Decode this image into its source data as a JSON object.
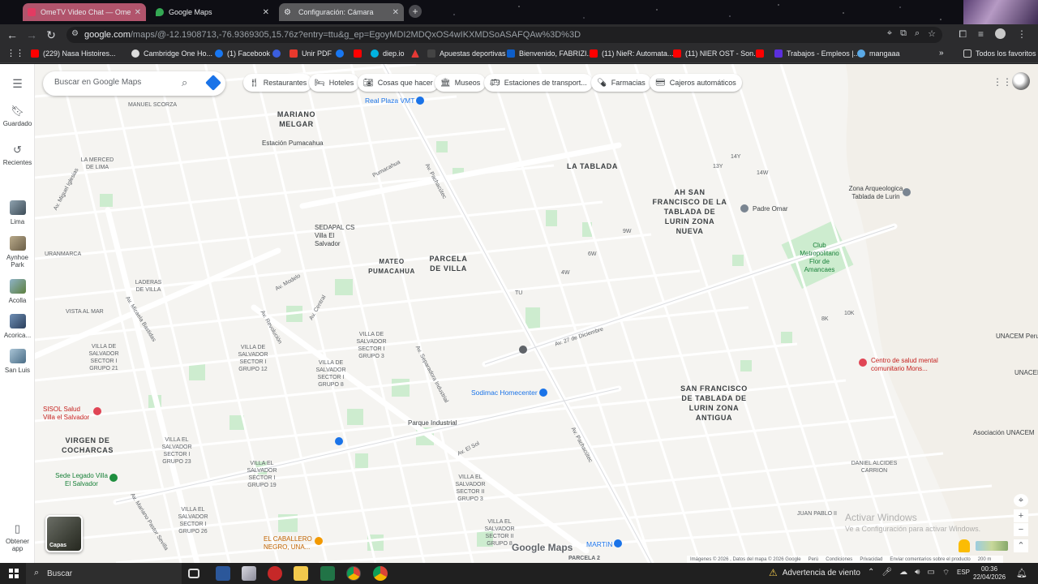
{
  "browser": {
    "tabs": [
      {
        "label": "OmeTV Video Chat — Ome",
        "color": "#b1546c"
      },
      {
        "label": "Google Maps",
        "color": "#34a853"
      },
      {
        "label": "Configuración: Cámara",
        "color": "#8ab4f8"
      }
    ],
    "url_host": "google.com",
    "url_path": "/maps/@-12.1908713,-76.9369305,15.76z?entry=ttu&g_ep=EgoyMDI2MDQxOS4wIKXMDSoASAFQAw%3D%3D",
    "bookmarks": [
      {
        "label": "(229) Nasa Histoires...",
        "color": "#ff0000"
      },
      {
        "label": "Cambridge One Ho...",
        "color": "#dddddd"
      },
      {
        "label": "(1) Facebook",
        "color": "#1877f2"
      },
      {
        "label": "",
        "color": "#3b5ede"
      },
      {
        "label": "Unir PDF",
        "color": "#e8392d"
      },
      {
        "label": "",
        "color": "#1877f2"
      },
      {
        "label": "",
        "color": "#ff0000"
      },
      {
        "label": "diep.io",
        "color": "#00b2e1"
      },
      {
        "label": "",
        "color": "#e53935"
      },
      {
        "label": "Apuestas deportivas",
        "color": "#444444"
      },
      {
        "label": "Bienvenido, FABRIZI...",
        "color": "#0e5ec9"
      },
      {
        "label": "(11) NieR: Automata...",
        "color": "#ff0000"
      },
      {
        "label": "(11) NIER OST - Son...",
        "color": "#ff0000"
      },
      {
        "label": "",
        "color": "#ff0000"
      },
      {
        "label": "Trabajos - Empleos |...",
        "color": "#5b2fdd"
      },
      {
        "label": "mangaaa",
        "color": "#5aa9e6"
      }
    ],
    "all_bookmarks": "Todos los favoritos"
  },
  "maps": {
    "search_placeholder": "Buscar en Google Maps",
    "chips": [
      {
        "label": "Restaurantes",
        "icon": "fork-knife-icon",
        "glyph": "🍴"
      },
      {
        "label": "Hoteles",
        "icon": "bed-icon",
        "glyph": "🛏"
      },
      {
        "label": "Cosas que hacer",
        "icon": "camera-icon",
        "glyph": "📷"
      },
      {
        "label": "Museos",
        "icon": "museum-icon",
        "glyph": "🏛"
      },
      {
        "label": "Estaciones de transport...",
        "icon": "bus-icon",
        "glyph": "🚌"
      },
      {
        "label": "Farmacias",
        "icon": "pharmacy-icon",
        "glyph": "💊"
      },
      {
        "label": "Cajeros automáticos",
        "icon": "atm-icon",
        "glyph": "💳"
      }
    ],
    "rail": [
      {
        "label": "Guardado",
        "icon": "bookmark-icon"
      },
      {
        "label": "Recientes",
        "icon": "history-icon"
      },
      {
        "label": "Lima",
        "icon": "lima-thumb"
      },
      {
        "label": "Aynhoe Park",
        "icon": "aynhoe-thumb"
      },
      {
        "label": "Acolla",
        "icon": "acolla-thumb"
      },
      {
        "label": "Acorica...",
        "icon": "acorica-thumb"
      },
      {
        "label": "San Luis",
        "icon": "sanluis-thumb"
      },
      {
        "label": "Obtener app",
        "icon": "phone-icon"
      }
    ],
    "layers_label": "Capas",
    "logo": "Google Maps",
    "footer": [
      "Imágenes © 2026 , Datos del mapa © 2026 Google",
      "Perú",
      "Condiciones",
      "Privacidad",
      "Enviar comentarios sobre el producto",
      "200 m"
    ],
    "activation_title": "Activar Windows",
    "activation_sub": "Ve a Configuración para activar Windows.",
    "labels": {
      "mariano_melgar": "MARIANO MELGAR",
      "la_tablada": "LA TABLADA",
      "ah_san_francisco": "AH SAN FRANCISCO DE LA TABLADA DE LURIN ZONA NUEVA",
      "parcela_villa": "PARCELA DE VILLA",
      "mateo_pumacahua": "MATEO PUMACAHUA",
      "san_francisco_antigua": "SAN FRANCISCO DE TABLADA DE LURIN ZONA ANTIGUA",
      "virgen_cocharcas": "VIRGEN DE COCHARCAS",
      "la_merced": "LA MERCED DE LIMA",
      "manuel_scorza": "MANUEL SCORZA",
      "uranmarca": "URANMARCA",
      "laderas_villa": "LADERAS DE VILLA",
      "vista_al_mar": "VISTA AL MAR",
      "daniel_carrion": "DANIEL ALCIDES CARRION",
      "juan_pablo": "JUAN PABLO II",
      "parcela_2": "PARCELA 2",
      "real_plaza": "Real Plaza VMT",
      "estacion_pumacahua": "Estación Pumacahua",
      "sedapal": "SEDAPAL CS Villa El Salvador",
      "sodimac": "Sodimac Homecenter",
      "parque_industrial": "Parque Industrial",
      "padre_omar": "Padre Omar",
      "zona_arqueologica": "Zona Arqueologica Tablada de Lurin",
      "club_metropolitano": "Club Metropolitano Flor de Amancaes",
      "centro_salud": "Centro de salud mental comunitario Mons...",
      "sisol": "SISOL Salud Villa el Salvador",
      "sede_legado": "Sede Legado Villa El Salvador",
      "el_caballero": "EL CABALLERO NEGRO, UNA...",
      "martin": "MARTIN",
      "unacem_peru": "UNACEM Peru",
      "unacem": "UNACEM",
      "asociacion": "Asociación UNACEM",
      "av_pachacutec": "Av. Pachacútec",
      "av_pachacutec_2": "Av. Pachacútec",
      "av_27_dic": "Av. 27 de Diciembre",
      "av_el_sol": "Av. El Sol",
      "av_modelo": "Av. Modelo",
      "av_revolucion": "Av. Revolución",
      "av_central": "Av. Central",
      "av_mariano": "Av. Mariano Pastor Sevilla",
      "av_micaela": "Av. Micaela Bastidas",
      "av_miguel": "Av. Miguel Iglesias",
      "av_separadora": "Av. Separadora Industrial",
      "pumacahua": "Pumacahua",
      "villa_grupo_21": "VILLA DE SALVADOR SECTOR I GRUPO 21",
      "villa_grupo_12": "VILLA DE SALVADOR SECTOR I GRUPO 12",
      "villa_grupo_3": "VILLA DE SALVADOR SECTOR I GRUPO 3",
      "villa_grupo_8": "VILLA DE SALVADOR SECTOR I GRUPO 8",
      "villa_grupo_23": "VILLA EL SALVADOR SECTOR I GRUPO 23",
      "villa_grupo_19": "VILLA EL SALVADOR SECTOR I GRUPO 19",
      "villa_grupo_26": "VILLA EL SALVADOR SECTOR I GRUPO 26",
      "villa_sector_ii": "VILLA EL SALVADOR SECTOR II GRUPO 3",
      "villa_sector_ii_b": "VILLA EL SALVADOR SECTOR II GRUPO 8",
      "k14y": "14Y",
      "k13y": "13Y",
      "k14w": "14W",
      "k9w": "9W",
      "k6w": "6W",
      "k4w": "4W",
      "k10k": "10K",
      "k8k": "8K",
      "ktu": "TU"
    }
  },
  "taskbar": {
    "search_label": "Buscar",
    "weather": "Advertencia de viento",
    "lang": "ESP",
    "time": "00:36",
    "date": "22/04/2026"
  }
}
